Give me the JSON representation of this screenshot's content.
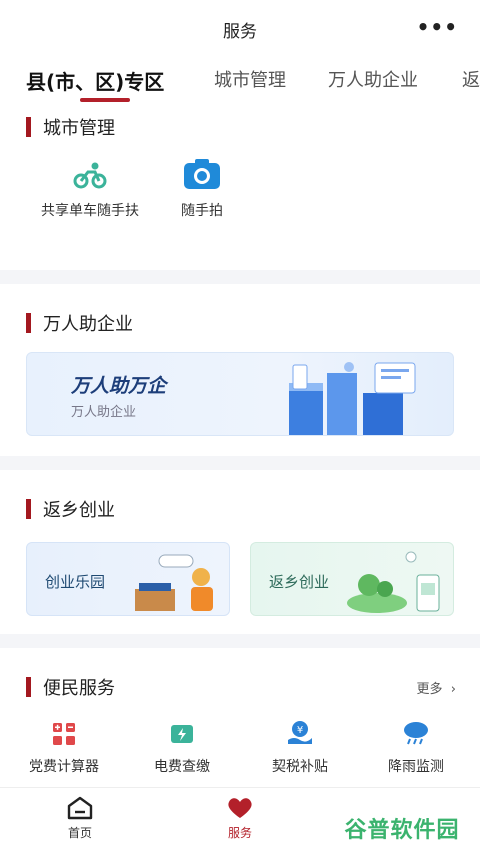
{
  "header": {
    "title": "服务",
    "more_icon": "more-dots-icon"
  },
  "tabs": [
    {
      "label": "县(市、区)专区",
      "active": true
    },
    {
      "label": "城市管理"
    },
    {
      "label": "万人助企业"
    },
    {
      "label": "返"
    }
  ],
  "city": {
    "title": "城市管理",
    "items": [
      {
        "label": "共享单车随手扶",
        "icon": "bike-icon"
      },
      {
        "label": "随手拍",
        "icon": "camera-icon"
      }
    ]
  },
  "enterprise": {
    "title": "万人助企业",
    "banner_title": "万人助万企",
    "banner_subtitle": "万人助企业"
  },
  "startup": {
    "title": "返乡创业",
    "card1": "创业乐园",
    "card2": "返乡创业"
  },
  "convenience": {
    "title": "便民服务",
    "more": "更多",
    "items": [
      {
        "label": "党费计算器",
        "icon": "calculator-icon"
      },
      {
        "label": "电费查缴",
        "icon": "battery-icon"
      },
      {
        "label": "契税补贴",
        "icon": "yen-hand-icon"
      },
      {
        "label": "降雨监测",
        "icon": "rain-cloud-icon"
      }
    ]
  },
  "bottom_nav": [
    {
      "label": "首页",
      "icon": "home-icon"
    },
    {
      "label": "服务",
      "icon": "heart-icon",
      "active": true
    }
  ],
  "watermark": "谷普软件园",
  "colors": {
    "accent": "#b3202a",
    "blue": "#2b82d6",
    "green": "#3bb36e"
  }
}
